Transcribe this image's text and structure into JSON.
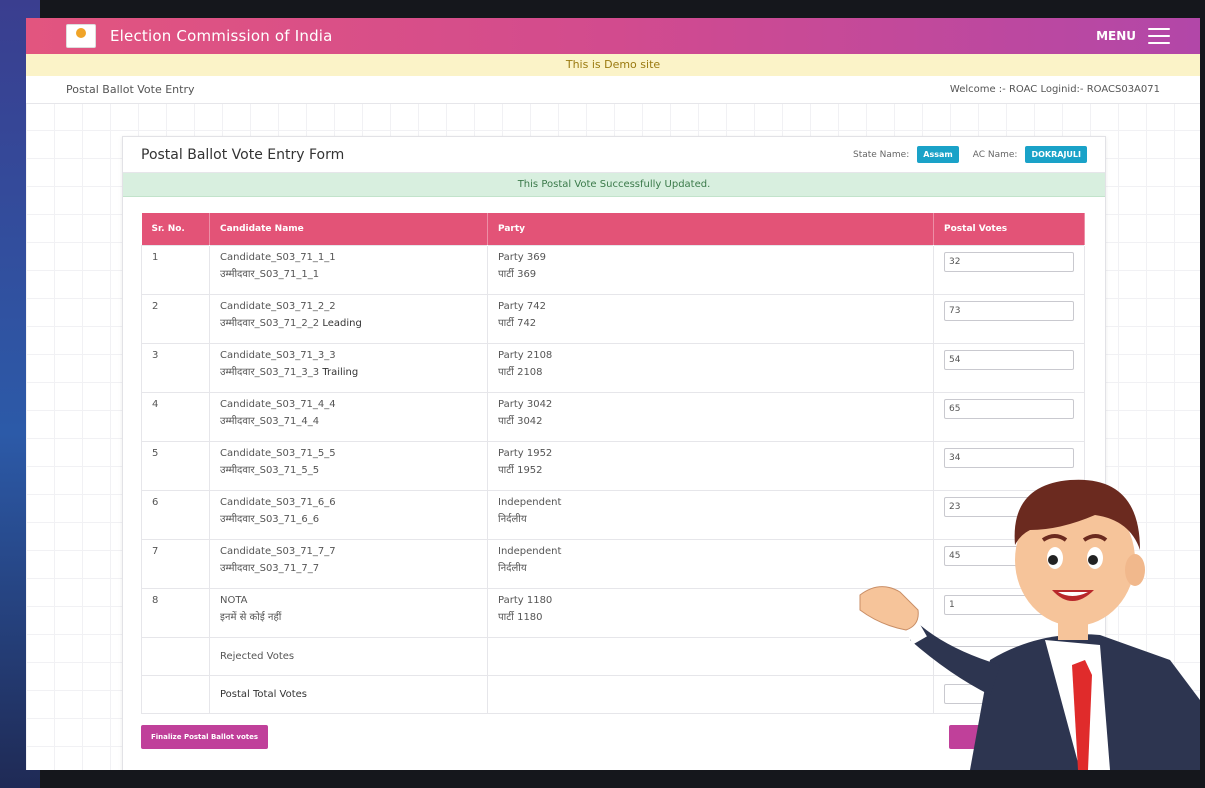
{
  "app": {
    "title": "Election Commission of India",
    "menu_label": "MENU"
  },
  "demo_banner": "This is Demo site",
  "subheader": {
    "page": "Postal Ballot Vote Entry",
    "welcome": "Welcome :- ROAC Loginid:- ROACS03A071"
  },
  "form": {
    "title": "Postal Ballot Vote Entry Form",
    "state_label": "State Name:",
    "state_value": "Assam",
    "ac_label": "AC Name:",
    "ac_value": "DOKRAJULI",
    "success_message": "This Postal Vote Successfully Updated."
  },
  "table": {
    "headers": [
      "Sr. No.",
      "Candidate Name",
      "Party",
      "Postal Votes"
    ],
    "rows": [
      {
        "sn": "1",
        "cand_en": "Candidate_S03_71_1_1",
        "cand_hi": "उम्मीदवार_S03_71_1_1",
        "status": "",
        "party_en": "Party 369",
        "party_hi": "पार्टी 369",
        "votes": "32"
      },
      {
        "sn": "2",
        "cand_en": "Candidate_S03_71_2_2",
        "cand_hi": "उम्मीदवार_S03_71_2_2",
        "status": "Leading",
        "party_en": "Party 742",
        "party_hi": "पार्टी 742",
        "votes": "73"
      },
      {
        "sn": "3",
        "cand_en": "Candidate_S03_71_3_3",
        "cand_hi": "उम्मीदवार_S03_71_3_3",
        "status": "Trailing",
        "party_en": "Party 2108",
        "party_hi": "पार्टी 2108",
        "votes": "54"
      },
      {
        "sn": "4",
        "cand_en": "Candidate_S03_71_4_4",
        "cand_hi": "उम्मीदवार_S03_71_4_4",
        "status": "",
        "party_en": "Party 3042",
        "party_hi": "पार्टी 3042",
        "votes": "65"
      },
      {
        "sn": "5",
        "cand_en": "Candidate_S03_71_5_5",
        "cand_hi": "उम्मीदवार_S03_71_5_5",
        "status": "",
        "party_en": "Party 1952",
        "party_hi": "पार्टी 1952",
        "votes": "34"
      },
      {
        "sn": "6",
        "cand_en": "Candidate_S03_71_6_6",
        "cand_hi": "उम्मीदवार_S03_71_6_6",
        "status": "",
        "party_en": "Independent",
        "party_hi": "निर्दलीय",
        "votes": "23"
      },
      {
        "sn": "7",
        "cand_en": "Candidate_S03_71_7_7",
        "cand_hi": "उम्मीदवार_S03_71_7_7",
        "status": "",
        "party_en": "Independent",
        "party_hi": "निर्दलीय",
        "votes": "45"
      },
      {
        "sn": "8",
        "cand_en": "NOTA",
        "cand_hi": "इनमें से कोई नहीं",
        "status": "",
        "party_en": "Party 1180",
        "party_hi": "पार्टी 1180",
        "votes": "1"
      }
    ],
    "rejected_label": "Rejected Votes",
    "total_label": "Postal Total Votes"
  },
  "buttons": {
    "finalize": "Finalize Postal Ballot votes"
  },
  "colors": {
    "header_gradient_start": "#e2557f",
    "header_gradient_end": "#b247a8",
    "table_header": "#e35377",
    "tag": "#1aa2c8"
  },
  "icons": {
    "menu": "hamburger-icon",
    "logo": "eci-logo-icon"
  }
}
